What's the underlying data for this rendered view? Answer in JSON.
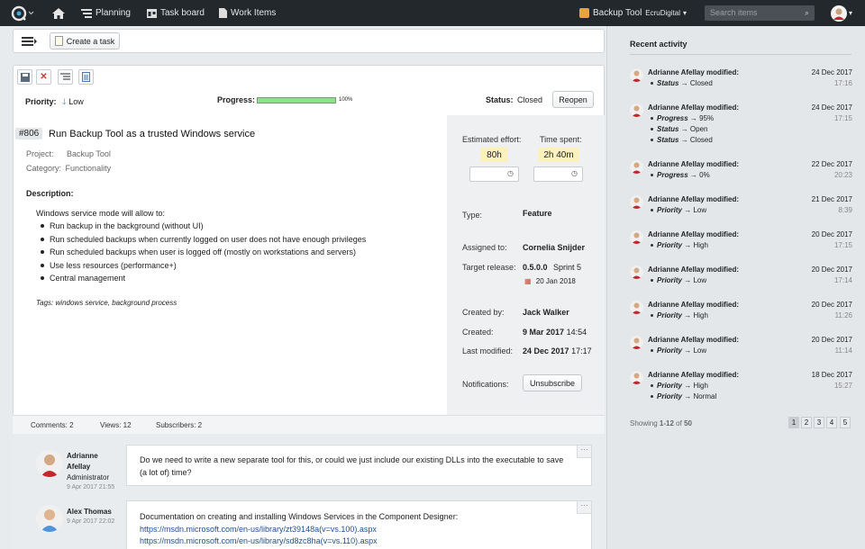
{
  "topbar": {
    "nav": [
      "Planning",
      "Task board",
      "Work Items"
    ],
    "project": "Backup Tool",
    "org": "EcruDigital",
    "search_placeholder": "Search items"
  },
  "toolbar": {
    "create_task": "Create a task"
  },
  "item": {
    "priority_label": "Priority:",
    "priority": "Low",
    "progress_label": "Progress:",
    "progress": 100,
    "progress_text": "100%",
    "status_label": "Status:",
    "status": "Closed",
    "reopen": "Reopen",
    "id": "#806",
    "title": "Run Backup Tool as a trusted Windows service",
    "project_label": "Project:",
    "project": "Backup Tool",
    "category_label": "Category:",
    "category": "Functionality",
    "description_label": "Description:",
    "desc_intro": "Windows service mode will allow to:",
    "desc_items": [
      "Run backup in the background (without UI)",
      "Run scheduled backups when currently logged on user does not have enough privileges",
      "Run scheduled backups when user is logged off (mostly on workstations and servers)",
      "Use less resources (performance+)",
      "Central management"
    ],
    "tags_label": "Tags:",
    "tags": "windows service, background process"
  },
  "details": {
    "est_label": "Estimated effort:",
    "est": "80h",
    "spent_label": "Time spent:",
    "spent": "2h 40m",
    "type_label": "Type:",
    "type": "Feature",
    "assigned_label": "Assigned to:",
    "assigned": "Cornelia Snijder",
    "release_label": "Target release:",
    "release_ver": "0.5.0.0",
    "release_sprint": "Sprint 5",
    "release_date": "20 Jan 2018",
    "created_by_label": "Created by:",
    "created_by": "Jack Walker",
    "created_label": "Created:",
    "created_date": "9 Mar 2017",
    "created_time": "14:54",
    "modified_label": "Last modified:",
    "modified_date": "24 Dec 2017",
    "modified_time": "17:17",
    "notif_label": "Notifications:",
    "unsubscribe": "Unsubscribe"
  },
  "counts": {
    "comments": "Comments: 2",
    "views": "Views: 12",
    "subscribers": "Subscribers: 2"
  },
  "comments": [
    {
      "name1": "Adrianne",
      "name2": "Afellay",
      "role": "Administrator",
      "date": "9 Apr 2017 21:55",
      "text1": "Do we need to write a new separate tool for this, or could we just include our existing DLLs into the executable to save",
      "text2": "(a lot of) time?"
    },
    {
      "name1": "Alex Thomas",
      "date": "9 Apr 2017 22:02",
      "text1": "Documentation on creating and installing Windows Services in the Component Designer:",
      "link1": "https://msdn.microsoft.com/en-us/library/zt39148a(v=vs.100).aspx",
      "link2": "https://msdn.microsoft.com/en-us/library/sd8zc8ha(v=vs.110).aspx"
    }
  ],
  "activity": {
    "title": "Recent activity",
    "entries": [
      {
        "who": "Adrianne Afellay modified:",
        "date": "24 Dec 2017",
        "time": "17:16",
        "changes": [
          [
            "Status",
            "Closed"
          ]
        ]
      },
      {
        "who": "Adrianne Afellay modified:",
        "date": "24 Dec 2017",
        "time": "17:15",
        "changes": [
          [
            "Progress",
            "95%"
          ],
          [
            "Status",
            "Open"
          ],
          [
            "Status",
            "Closed"
          ]
        ]
      },
      {
        "who": "Adrianne Afellay modified:",
        "date": "22 Dec 2017",
        "time": "20:23",
        "changes": [
          [
            "Progress",
            "0%"
          ]
        ]
      },
      {
        "who": "Adrianne Afellay modified:",
        "date": "21 Dec 2017",
        "time": "8:39",
        "changes": [
          [
            "Priority",
            "Low"
          ]
        ]
      },
      {
        "who": "Adrianne Afellay modified:",
        "date": "20 Dec 2017",
        "time": "17:15",
        "changes": [
          [
            "Priority",
            "High"
          ]
        ]
      },
      {
        "who": "Adrianne Afellay modified:",
        "date": "20 Dec 2017",
        "time": "17:14",
        "changes": [
          [
            "Priority",
            "Low"
          ]
        ]
      },
      {
        "who": "Adrianne Afellay modified:",
        "date": "20 Dec 2017",
        "time": "11:26",
        "changes": [
          [
            "Priority",
            "High"
          ]
        ]
      },
      {
        "who": "Adrianne Afellay modified:",
        "date": "20 Dec 2017",
        "time": "11:14",
        "changes": [
          [
            "Priority",
            "Low"
          ]
        ]
      },
      {
        "who": "Adrianne Afellay modified:",
        "date": "18 Dec 2017",
        "time": "15:27",
        "changes": [
          [
            "Priority",
            "High"
          ],
          [
            "Priority",
            "Normal"
          ]
        ]
      }
    ],
    "showing_prefix": "Showing",
    "showing_range": "1-12",
    "showing_of": "of",
    "showing_total": "50",
    "pages": [
      "1",
      "2",
      "3",
      "4",
      "5"
    ]
  },
  "colors": {
    "topbar": "#23282d",
    "progress": "#8fe08a",
    "highlight": "#fbf1bd",
    "accent": "#e8a33a"
  }
}
